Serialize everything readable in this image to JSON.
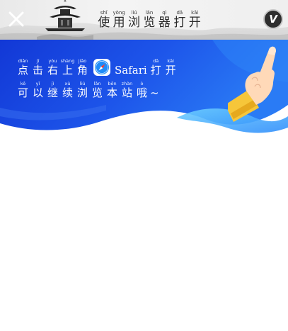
{
  "header": {
    "close_icon": "close-icon",
    "title_chars": [
      {
        "hz": "使",
        "py": "shǐ"
      },
      {
        "hz": "用",
        "py": "yòng"
      },
      {
        "hz": "浏",
        "py": "liú"
      },
      {
        "hz": "览",
        "py": "lǎn"
      },
      {
        "hz": "器",
        "py": "qì"
      },
      {
        "hz": "打",
        "py": "dǎ"
      },
      {
        "hz": "开",
        "py": "kāi"
      }
    ],
    "logo_letter": "V"
  },
  "banner": {
    "line1_chars": [
      {
        "hz": "点",
        "py": "diǎn"
      },
      {
        "hz": "击",
        "py": "jī"
      },
      {
        "hz": "右",
        "py": "yòu"
      },
      {
        "hz": "上",
        "py": "shàng"
      },
      {
        "hz": "角",
        "py": "jiǎo"
      }
    ],
    "safari_label": "Safari",
    "line1_tail": [
      {
        "hz": "打",
        "py": "dǎ"
      },
      {
        "hz": "开",
        "py": "kāi"
      }
    ],
    "line2_chars": [
      {
        "hz": "可",
        "py": "kě"
      },
      {
        "hz": "以",
        "py": "yǐ"
      },
      {
        "hz": "继",
        "py": "jì"
      },
      {
        "hz": "续",
        "py": "xù"
      },
      {
        "hz": "浏",
        "py": "liú"
      },
      {
        "hz": "览",
        "py": "lǎn"
      },
      {
        "hz": "本",
        "py": "běn"
      },
      {
        "hz": "站",
        "py": "zhàn"
      },
      {
        "hz": "哦",
        "py": "ò"
      }
    ],
    "line2_tail": "~",
    "colors": {
      "blue_deep": "#1238d6",
      "blue_mid": "#1f64ef",
      "blue_light": "#4fb3ff",
      "hand_cuff": "#f6c63a"
    }
  }
}
